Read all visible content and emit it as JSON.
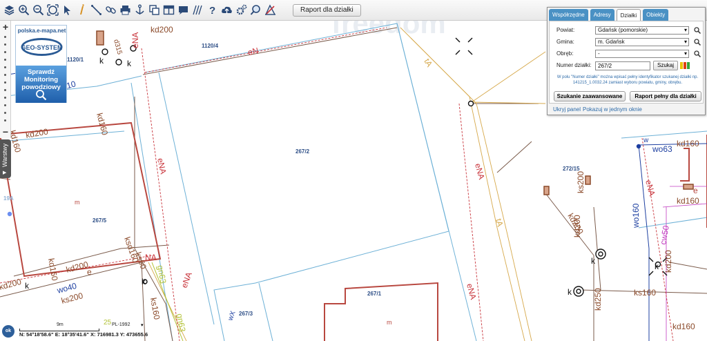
{
  "toolbar": {
    "report_label": "Raport dla działki",
    "tools": [
      "layers-icon",
      "zoom-in-icon",
      "zoom-out-icon",
      "full-extent-icon",
      "pointer-icon",
      "info-icon",
      "measure-icon",
      "link-icon",
      "print-icon",
      "anchor-icon",
      "copy-icon",
      "layout-icon",
      "comment-icon",
      "hatch-icon",
      "help-icon",
      "cloud-upload-icon",
      "settings-icon",
      "search-map-icon",
      "reset-icon"
    ]
  },
  "left_strip": {
    "zoom_in": "+",
    "zoom_out": "−",
    "layers_label": "Warstwy"
  },
  "promo": {
    "site": "polska.e-mapa.net",
    "logo": "GEO-SYSTEM",
    "banner": [
      "Sprawdź",
      "Monitoring",
      "powodziowy"
    ]
  },
  "panel": {
    "tabs": [
      {
        "label": "Współrzędne",
        "active": false
      },
      {
        "label": "Adresy",
        "active": false
      },
      {
        "label": "Działki",
        "active": true
      },
      {
        "label": "Obiekty",
        "active": false
      }
    ],
    "powiat_label": "Powiat:",
    "powiat_value": "Gdańsk (pomorskie)",
    "gmina_label": "Gmina:",
    "gmina_value": "m. Gdańsk",
    "obreb_label": "Obręb:",
    "obreb_value": "-",
    "numer_label": "Numer działki:",
    "numer_value": "267/2",
    "search_label": "Szukaj",
    "hint_text": "W polu \"Numer działki\" można wpisać pełny identyfikator szukanej działki np. 141215_1.0032.24 zamiast wyboru powiatu, gminy, obrębu.",
    "advanced_label": "Szukanie zaawansowane",
    "report_label": "Raport pełny dla działki",
    "hide_label": "Ukryj panel",
    "one_window_label": "Pokazuj w jednym oknie",
    "swatch_colors": [
      "#e8c400",
      "#e04010",
      "#37a337"
    ]
  },
  "map": {
    "parcel_labels": [
      "267/2",
      "267/5",
      "267/1",
      "267/3",
      "272/15",
      "1120/4",
      "1120/1",
      "19A"
    ],
    "utility_labels": [
      "eN",
      "eNA",
      "kd200",
      "kd160",
      "ks200",
      "ks160",
      "ks250",
      "gn63",
      "wo40",
      "wo63",
      "wo160",
      "cw50",
      "tA",
      "k",
      "e",
      "m",
      "w",
      "NA",
      "ksd160",
      "110",
      "d315"
    ],
    "colors": {
      "parcel": "#6cb0d6",
      "building": "#b8473f",
      "sewer": "#8b4a2a",
      "electric": "#c8333a",
      "water": "#1d3fa0",
      "telecom": "#d6a84a",
      "gas": "#b2c236",
      "heating": "#c03bc0"
    }
  },
  "status": {
    "scale_text": "9m",
    "crs": "PL-1992",
    "coords": "N: 54°18'58.6\"  E: 18°35'41.6\"  X: 716981.3  Y: 473655.6",
    "ok_label": "ok"
  }
}
